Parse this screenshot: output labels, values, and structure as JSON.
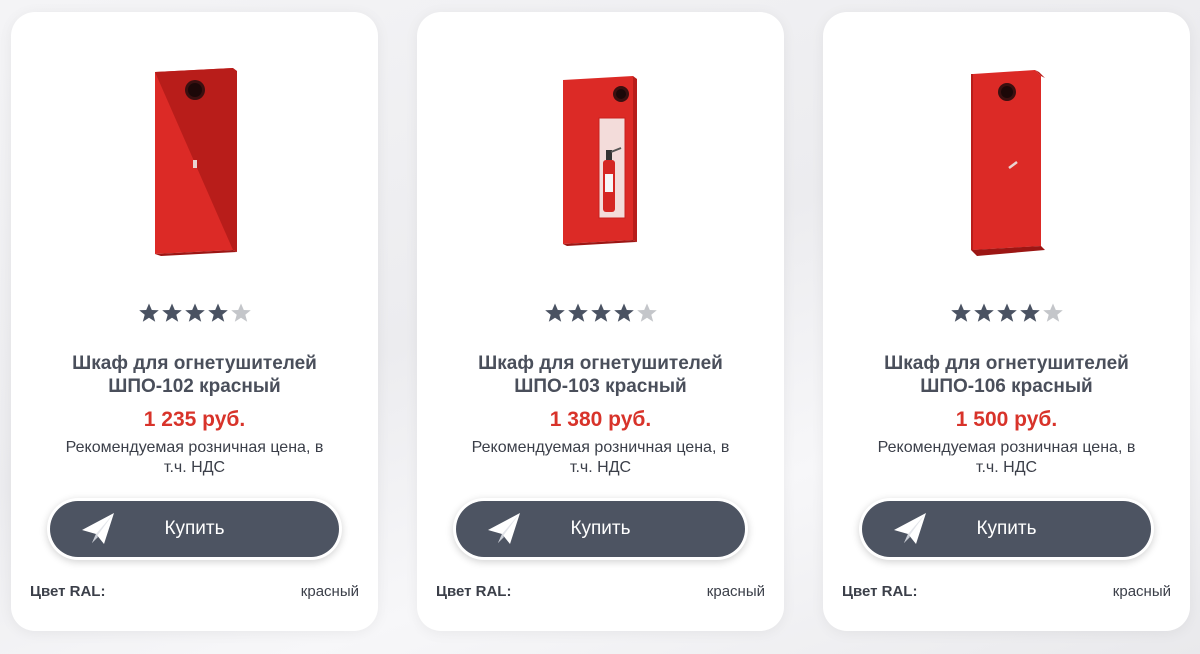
{
  "products": [
    {
      "image_name": "fire-cabinet-shpo-102-image",
      "rating": 4,
      "rating_max": 5,
      "title_line1": "Шкаф для огнетушителей",
      "title_line2": "ШПО-102 красный",
      "price": "1 235 руб.",
      "price_note_line1": "Рекомендуемая розничная цена, в",
      "price_note_line2": "т.ч. НДС",
      "buy_label": "Купить",
      "spec_label": "Цвет RAL:",
      "spec_value": "красный"
    },
    {
      "image_name": "fire-cabinet-shpo-103-image",
      "rating": 4,
      "rating_max": 5,
      "title_line1": "Шкаф для огнетушителей",
      "title_line2": "ШПО-103 красный",
      "price": "1 380 руб.",
      "price_note_line1": "Рекомендуемая розничная цена, в",
      "price_note_line2": "т.ч. НДС",
      "buy_label": "Купить",
      "spec_label": "Цвет RAL:",
      "spec_value": "красный"
    },
    {
      "image_name": "fire-cabinet-shpo-106-image",
      "rating": 4,
      "rating_max": 5,
      "title_line1": "Шкаф для огнетушителей",
      "title_line2": "ШПО-106 красный",
      "price": "1 500 руб.",
      "price_note_line1": "Рекомендуемая розничная цена, в",
      "price_note_line2": "т.ч. НДС",
      "buy_label": "Купить",
      "spec_label": "Цвет RAL:",
      "spec_value": "красный"
    }
  ],
  "colors": {
    "price": "#d8332a",
    "button": "#4d5462",
    "star_filled": "#4a5262",
    "star_empty": "#c4c6ca",
    "cabinet_red": "#dc2a26"
  },
  "icons": {
    "buy_button_icon": "paper-plane-icon",
    "rating_icon": "star-icon"
  }
}
